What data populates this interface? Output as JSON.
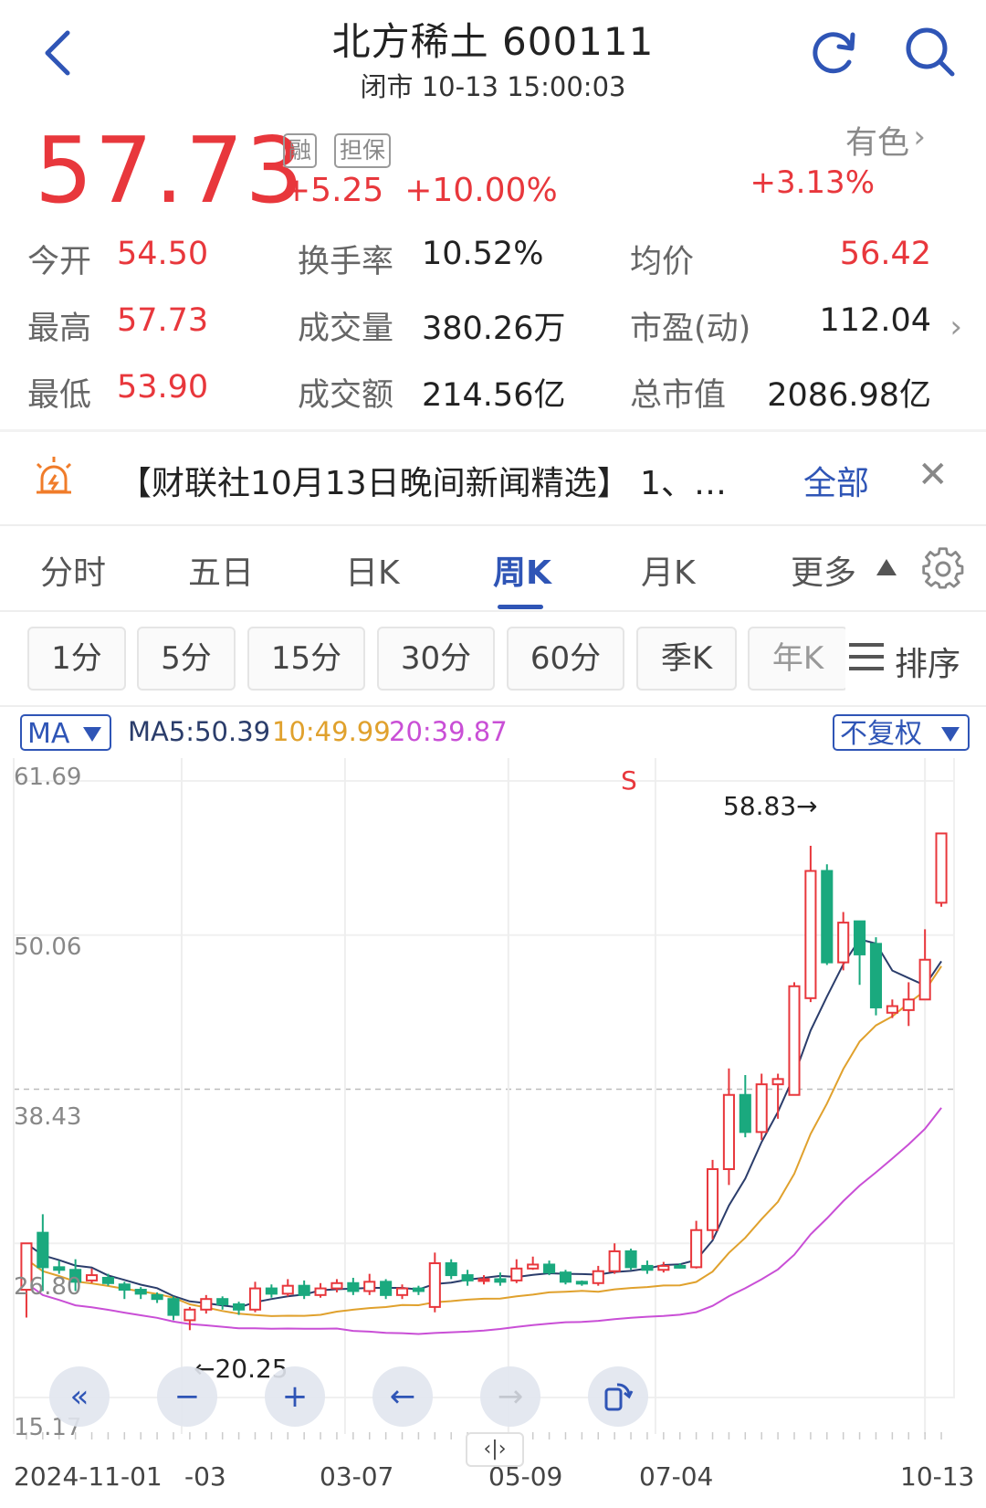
{
  "header": {
    "title": "北方稀土 600111",
    "subtitle": "闭市 10-13 15:00:03",
    "back_icon": "chevron-left-icon",
    "refresh_icon": "refresh-icon",
    "search_icon": "search-icon"
  },
  "quote": {
    "price": "57.73",
    "tag_margin": "融",
    "tag_collateral": "担保",
    "change": "+5.25",
    "change_pct": "+10.00%",
    "sector_name": "有色",
    "sector_pct": "+3.13%"
  },
  "stats": [
    {
      "label": "今开",
      "value": "54.50"
    },
    {
      "label": "最高",
      "value": "57.73"
    },
    {
      "label": "最低",
      "value": "53.90"
    },
    {
      "label": "换手率",
      "value": "10.52%"
    },
    {
      "label": "成交量",
      "value": "380.26万"
    },
    {
      "label": "成交额",
      "value": "214.56亿"
    },
    {
      "label": "均价",
      "value": "56.42"
    },
    {
      "label": "市盈(动)",
      "value": "112.04"
    },
    {
      "label": "总市值",
      "value": "2086.98亿"
    }
  ],
  "news": {
    "text": "【财联社10月13日晚间新闻精选】 1、…",
    "all_label": "全部",
    "close_label": "✕"
  },
  "tabs": [
    "分时",
    "五日",
    "日K",
    "周K",
    "月K",
    "更多"
  ],
  "active_tab": "周K",
  "periods": [
    "1分",
    "5分",
    "15分",
    "30分",
    "60分",
    "季K",
    "年K"
  ],
  "sort_label": "排序",
  "indicator": {
    "ma_label": "MA",
    "ma5": "MA5:50.39",
    "ma10": "10:49.99",
    "ma20": "20:39.87",
    "fq_label": "不复权"
  },
  "colors": {
    "up": "#e8373c",
    "down": "#1aa97e",
    "accent": "#2f55b6",
    "ma5": "#2b3d6b",
    "ma10": "#e0a12d",
    "ma20": "#c94fd6"
  },
  "chart_data": {
    "type": "candlestick",
    "y_ticks": [
      "61.69",
      "50.06",
      "38.43",
      "26.80",
      "15.17"
    ],
    "ylim": [
      15.17,
      61.69
    ],
    "x_labels": [
      "2024-11-01",
      "-03",
      "03-07",
      "05-09",
      "07-04",
      "10-13"
    ],
    "high_label": "58.83→",
    "low_label": "←20.25",
    "signal_label": "S",
    "candles": [
      [
        23.3,
        26.8,
        21.2,
        26.8
      ],
      [
        27.6,
        25.0,
        23.2,
        29.0
      ],
      [
        25.0,
        24.8,
        24.5,
        25.5
      ],
      [
        24.8,
        23.9,
        23.2,
        25.6
      ],
      [
        24.0,
        24.4,
        23.8,
        24.9
      ],
      [
        24.2,
        23.8,
        23.6,
        24.5
      ],
      [
        23.7,
        23.3,
        22.6,
        23.9
      ],
      [
        23.3,
        23.0,
        22.6,
        23.5
      ],
      [
        22.9,
        22.6,
        22.3,
        23.1
      ],
      [
        22.6,
        21.4,
        21.0,
        22.8
      ],
      [
        21.0,
        21.8,
        20.25,
        22.0
      ],
      [
        21.8,
        22.6,
        21.5,
        22.9
      ],
      [
        22.6,
        22.2,
        21.8,
        22.8
      ],
      [
        22.2,
        21.8,
        21.4,
        22.4
      ],
      [
        21.8,
        23.4,
        21.6,
        23.9
      ],
      [
        23.4,
        23.0,
        22.7,
        23.7
      ],
      [
        23.0,
        23.6,
        22.8,
        24.1
      ],
      [
        23.6,
        22.9,
        22.6,
        24.0
      ],
      [
        22.9,
        23.4,
        22.7,
        23.8
      ],
      [
        23.4,
        23.8,
        23.1,
        24.1
      ],
      [
        23.8,
        23.2,
        22.9,
        24.2
      ],
      [
        23.2,
        23.9,
        22.9,
        24.5
      ],
      [
        23.9,
        22.9,
        22.6,
        24.1
      ],
      [
        22.9,
        23.4,
        22.6,
        23.7
      ],
      [
        23.4,
        23.2,
        22.9,
        23.6
      ],
      [
        22.0,
        25.3,
        21.6,
        26.1
      ],
      [
        25.3,
        24.4,
        24.1,
        25.6
      ],
      [
        24.4,
        24.0,
        23.6,
        24.8
      ],
      [
        24.0,
        24.1,
        23.7,
        24.4
      ],
      [
        24.1,
        23.9,
        23.6,
        24.6
      ],
      [
        24.0,
        24.9,
        23.8,
        25.6
      ],
      [
        24.9,
        25.2,
        24.8,
        25.8
      ],
      [
        25.2,
        24.6,
        24.4,
        25.5
      ],
      [
        24.6,
        23.9,
        23.7,
        24.8
      ],
      [
        23.9,
        23.8,
        23.6,
        24.0
      ],
      [
        23.8,
        24.7,
        23.6,
        25.1
      ],
      [
        24.7,
        26.2,
        24.5,
        26.8
      ],
      [
        26.2,
        25.0,
        24.8,
        26.4
      ],
      [
        25.1,
        24.8,
        24.5,
        25.5
      ],
      [
        24.8,
        25.1,
        24.6,
        25.4
      ],
      [
        25.1,
        25.0,
        24.9,
        25.3
      ],
      [
        25.0,
        27.8,
        24.9,
        28.5
      ],
      [
        27.8,
        32.4,
        27.1,
        33.1
      ],
      [
        32.4,
        38.0,
        31.2,
        40.0
      ],
      [
        38.0,
        35.2,
        34.8,
        39.5
      ],
      [
        35.2,
        38.8,
        34.6,
        39.6
      ],
      [
        38.8,
        39.2,
        36.2,
        39.6
      ],
      [
        38.0,
        46.2,
        38.0,
        46.5
      ],
      [
        45.3,
        54.9,
        45.0,
        56.8
      ],
      [
        54.9,
        48.0,
        47.8,
        55.4
      ],
      [
        48.0,
        51.0,
        47.4,
        51.8
      ],
      [
        51.1,
        48.6,
        46.3,
        51.1
      ],
      [
        49.4,
        44.6,
        44.0,
        49.9
      ],
      [
        44.2,
        44.7,
        43.8,
        45.2
      ],
      [
        44.4,
        45.2,
        43.2,
        46.5
      ],
      [
        45.2,
        48.2,
        45.2,
        50.5
      ],
      [
        52.5,
        57.73,
        52.2,
        57.73
      ]
    ]
  }
}
